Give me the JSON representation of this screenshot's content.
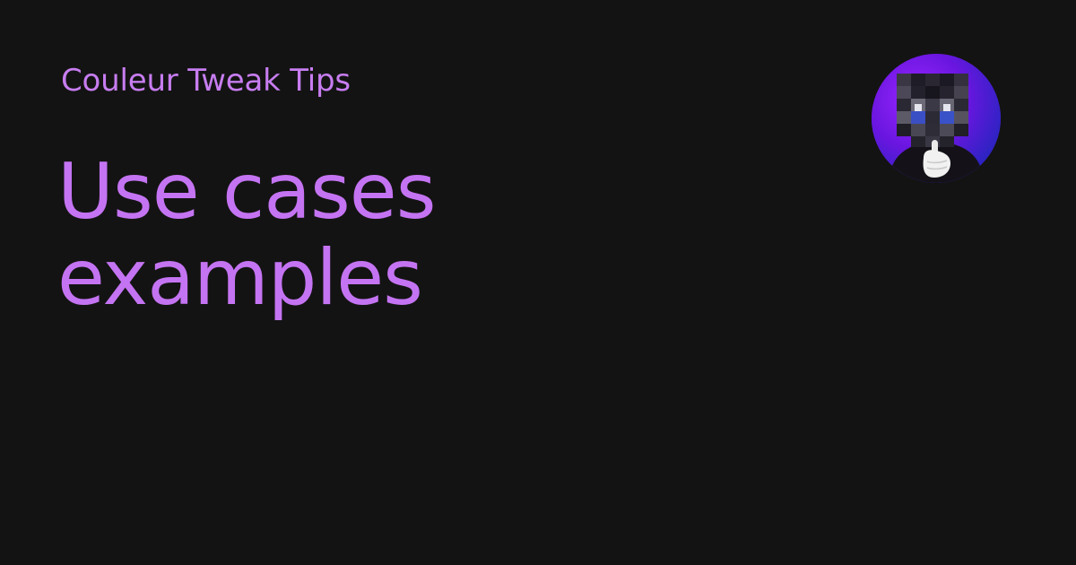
{
  "site": {
    "name": "Couleur Tweak Tips"
  },
  "page": {
    "title_lines": [
      "Use cases",
      "examples"
    ]
  },
  "avatar": {
    "icon": "pixelated-face-avatar-icon"
  },
  "colors": {
    "background": "#131313",
    "accent": "#c474f2",
    "avatar_ring_start": "#8a1cf0",
    "avatar_ring_end": "#3b22c8"
  }
}
